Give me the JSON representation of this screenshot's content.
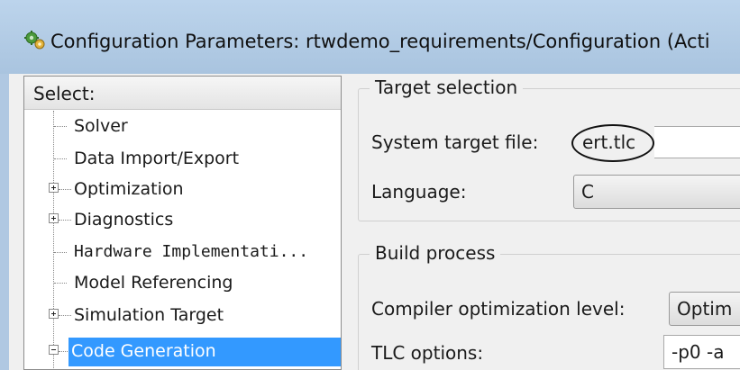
{
  "window": {
    "title": "Configuration Parameters: rtwdemo_requirements/Configuration (Acti",
    "icon": "gears-icon"
  },
  "select_panel": {
    "header": "Select:",
    "items": [
      {
        "label": "Solver",
        "expander": "none"
      },
      {
        "label": "Data Import/Export",
        "expander": "none"
      },
      {
        "label": "Optimization",
        "expander": "plus"
      },
      {
        "label": "Diagnostics",
        "expander": "plus"
      },
      {
        "label": "Hardware Implementati...",
        "expander": "none"
      },
      {
        "label": "Model Referencing",
        "expander": "none"
      },
      {
        "label": "Simulation Target",
        "expander": "plus"
      },
      {
        "label": "Code Generation",
        "expander": "minus",
        "selected": true
      }
    ]
  },
  "target_selection": {
    "legend": "Target selection",
    "system_target_label": "System target file:",
    "system_target_value": "ert.tlc",
    "language_label": "Language:",
    "language_value": "C"
  },
  "build_process": {
    "legend": "Build process",
    "compiler_label": "Compiler optimization level:",
    "compiler_value": "Optim",
    "tlc_label": "TLC options:",
    "tlc_value": "-p0 -a"
  },
  "colors": {
    "selection": "#3399ff",
    "titlebar": "#b4cde6",
    "dialog_bg": "#f0f0f0"
  }
}
